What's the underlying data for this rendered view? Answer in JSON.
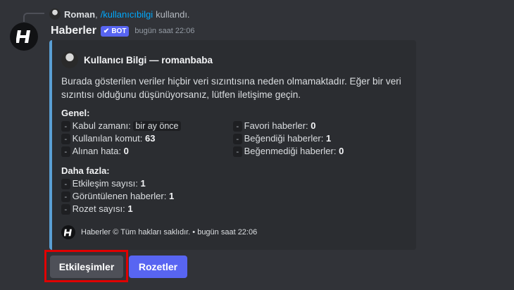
{
  "reply": {
    "user": "Roman",
    "separator": ",",
    "command": "/kullanıcıbilgi",
    "action": "kullandı."
  },
  "message": {
    "author": "Haberler",
    "bot_tag": "BOT",
    "timestamp": "bugün saat 22:06"
  },
  "embed": {
    "accent_color": "#5a9fd4",
    "author": "Kullanıcı Bilgi — romanbaba",
    "description": "Burada gösterilen veriler hiçbir veri sızıntısına neden olmamaktadır. Eğer bir veri sızıntısı olduğunu düşünüyorsanız, lütfen iletişime geçin.",
    "general": {
      "title": "Genel:",
      "left": [
        {
          "label": "Kabul zamanı:",
          "value": "bir ay önce"
        },
        {
          "label": "Kullanılan komut:",
          "value": "63"
        },
        {
          "label": "Alınan hata:",
          "value": "0"
        }
      ],
      "right": [
        {
          "label": "Favori haberler:",
          "value": "0"
        },
        {
          "label": "Beğendiği haberler:",
          "value": "1"
        },
        {
          "label": "Beğenmediği haberler:",
          "value": "0"
        }
      ]
    },
    "more": {
      "title": "Daha fazla:",
      "items": [
        {
          "label": "Etkileşim sayısı:",
          "value": "1"
        },
        {
          "label": "Görüntülenen haberler:",
          "value": "1"
        },
        {
          "label": "Rozet sayısı:",
          "value": "1"
        }
      ]
    },
    "dash": "-",
    "footer": "Haberler © Tüm hakları saklıdır. • bugün saat 22:06"
  },
  "buttons": {
    "interactions": "Etkileşimler",
    "badges": "Rozetler"
  },
  "colors": {
    "background": "#313338",
    "embed_bg": "#2b2d31",
    "primary": "#5865f2",
    "secondary": "#4e5058",
    "link": "#00a8fc",
    "highlight": "#e00000"
  }
}
